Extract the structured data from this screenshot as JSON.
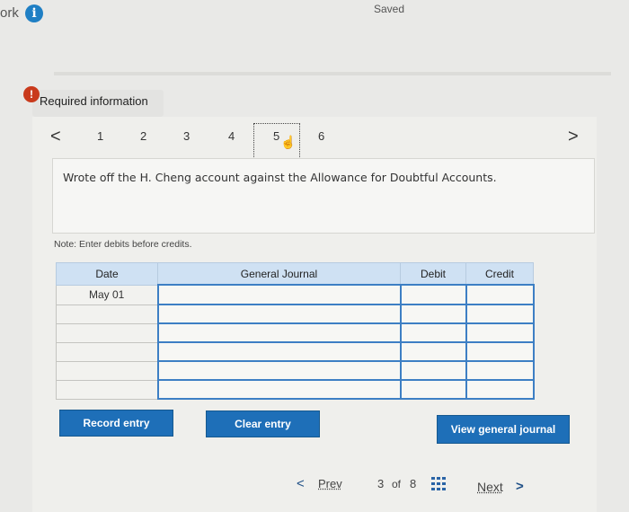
{
  "header": {
    "title": "ork",
    "info_icon": "info-icon",
    "status": "Saved"
  },
  "required_info": {
    "label": "Required information",
    "alert_icon": "!"
  },
  "steps": {
    "prev_arrow": "<",
    "next_arrow": ">",
    "items": [
      "1",
      "2",
      "3",
      "4",
      "5",
      "6"
    ],
    "current": "5"
  },
  "question": "Wrote off the H. Cheng account against the Allowance for Doubtful Accounts.",
  "note": "Note: Enter debits before credits.",
  "journal": {
    "columns": [
      "Date",
      "General Journal",
      "Debit",
      "Credit"
    ],
    "rows": [
      {
        "date": "May 01",
        "account": "",
        "debit": "",
        "credit": ""
      },
      {
        "date": "",
        "account": "",
        "debit": "",
        "credit": ""
      },
      {
        "date": "",
        "account": "",
        "debit": "",
        "credit": ""
      },
      {
        "date": "",
        "account": "",
        "debit": "",
        "credit": ""
      },
      {
        "date": "",
        "account": "",
        "debit": "",
        "credit": ""
      },
      {
        "date": "",
        "account": "",
        "debit": "",
        "credit": ""
      }
    ]
  },
  "buttons": {
    "record": "Record entry",
    "clear": "Clear entry",
    "view": "View general journal"
  },
  "footer": {
    "prev_arrow": "<",
    "prev": "Prev",
    "page": "3",
    "of": "of",
    "total": "8",
    "next": "Next",
    "next_arrow": ">"
  },
  "colors": {
    "accent": "#1e6fb8",
    "header_fill": "#cfe1f3",
    "alert": "#c93a1c"
  }
}
